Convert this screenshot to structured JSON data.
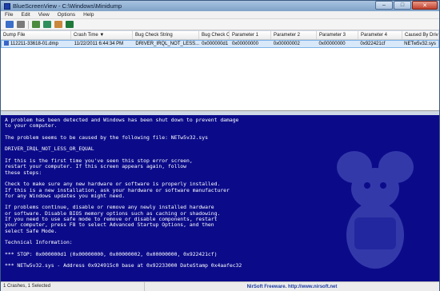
{
  "window": {
    "title": "BlueScreenView - C:\\Windows\\Minidump",
    "min_glyph": "–",
    "max_glyph": "□",
    "close_glyph": "✕"
  },
  "menu": [
    "File",
    "Edit",
    "View",
    "Options",
    "Help"
  ],
  "toolbar": {
    "icons": [
      "save-icon",
      "properties-icon",
      "copy-icon",
      "refresh-icon",
      "html-report-icon",
      "exit-icon"
    ],
    "colors": [
      "#3b6fc9",
      "#7a7a7a",
      "#4d8a3f",
      "#2f8f5b",
      "#c9883b",
      "#1f7a3a"
    ]
  },
  "list": {
    "columns": [
      "Dump File",
      "Crash Time",
      "Bug Check String",
      "Bug Check Code",
      "Parameter 1",
      "Parameter 2",
      "Parameter 3",
      "Parameter 4",
      "Caused By Driver"
    ],
    "sorted_column_marker": "▼",
    "rows": [
      {
        "dump_file": "112211-33618-01.dmp",
        "crash_time": "11/22/2011 6:44:34 PM",
        "bug_check_string": "DRIVER_IRQL_NOT_LESS...",
        "bug_check_code": "0x000000d1",
        "param1": "0x00000000",
        "param2": "0x00000002",
        "param3": "0x00000000",
        "param4": "0x922421cf",
        "caused_by": "NETw5v32.sys"
      }
    ]
  },
  "bsod": {
    "text": "A problem has been detected and Windows has been shut down to prevent damage\nto your computer.\n\nThe problem seems to be caused by the following file: NETw5v32.sys\n\nDRIVER_IRQL_NOT_LESS_OR_EQUAL\n\nIf this is the first time you've seen this stop error screen,\nrestart your computer. If this screen appears again, follow\nthese steps:\n\nCheck to make sure any new hardware or software is properly installed.\nIf this is a new installation, ask your hardware or software manufacturer\nfor any Windows updates you might need.\n\nIf problems continue, disable or remove any newly installed hardware\nor software. Disable BIOS memory options such as caching or shadowing.\nIf you need to use safe mode to remove or disable components, restart\nyour computer, press F8 to select Advanced Startup Options, and then\nselect Safe Mode.\n\nTechnical Information:\n\n*** STOP: 0x000000d1 (0x00000000, 0x00000002, 0x00000000, 0x922421cf)\n\n*** NETw5v32.sys - Address 0x924915c0 base at 0x92233000 DateStamp 0x4aafec32",
    "background": "#0b0b8a"
  },
  "status": {
    "selection": "1 Crashes, 1 Selected",
    "credit": "NirSoft Freeware.  http://www.nirsoft.net"
  }
}
